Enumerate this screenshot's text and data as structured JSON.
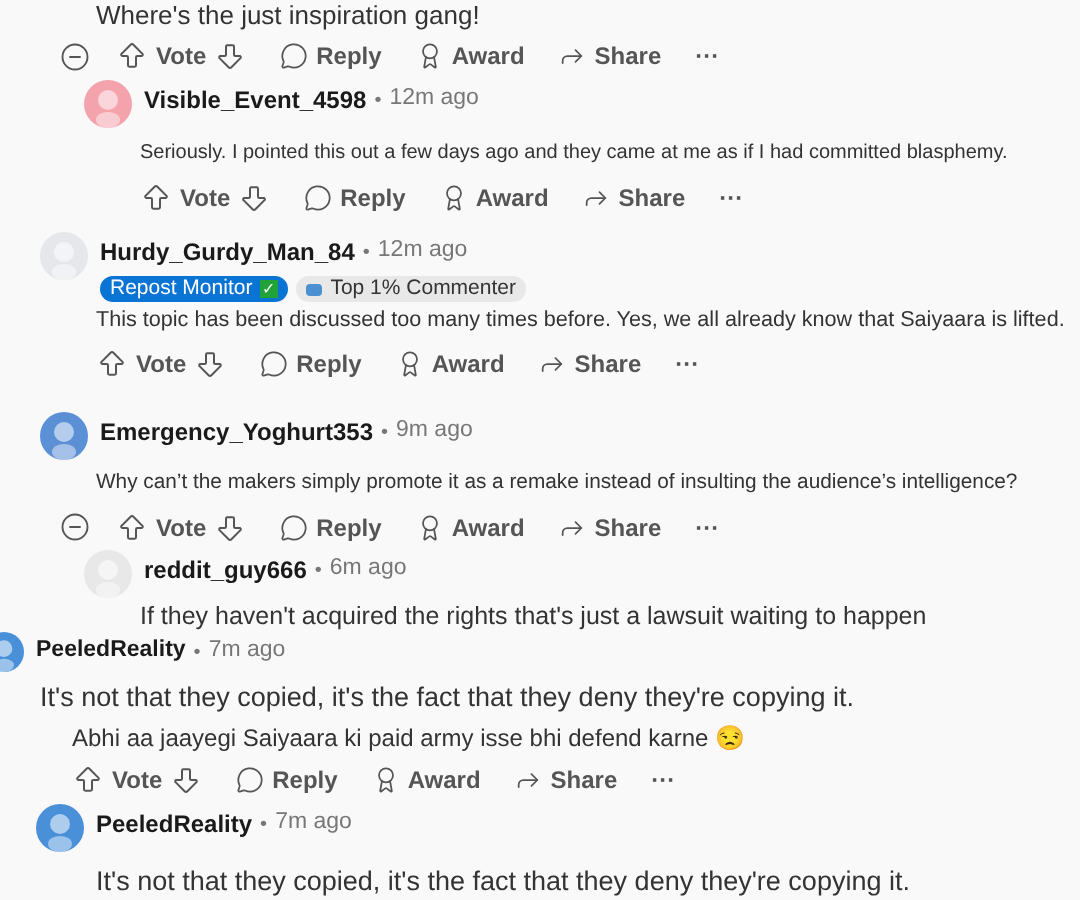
{
  "rows": [
    {
      "kind": "text",
      "text": "Where's the just inspiration gang!"
    },
    {
      "kind": "actions",
      "collapse": true,
      "vote": "Vote",
      "reply": "Reply",
      "award": "Award",
      "share": "Share",
      "more": "···"
    },
    {
      "kind": "author",
      "name": "Visible_Event_4598",
      "separator": "•",
      "time": "12m ago",
      "color": "#f4a3ad"
    },
    {
      "kind": "text",
      "text": "Seriously. I pointed this out a few days ago and they came at me as if I had committed blasphemy."
    },
    {
      "kind": "actions",
      "collapse": false,
      "vote": "Vote",
      "reply": "Reply",
      "award": "Award",
      "share": "Share",
      "more": "···"
    },
    {
      "kind": "author",
      "name": "Hurdy_Gurdy_Man_84",
      "separator": "•",
      "time": "12m ago",
      "color": "#e5e7eb",
      "badges": [
        {
          "kind": "flair",
          "label": "Repost Monitor",
          "check": "✓"
        },
        {
          "kind": "achievement",
          "label": "Top 1% Commenter"
        }
      ]
    },
    {
      "kind": "text",
      "text": "This topic has been discussed too many times before. Yes, we all already know that Saiyaara is lifted."
    },
    {
      "kind": "actions",
      "collapse": false,
      "vote": "Vote",
      "reply": "Reply",
      "award": "Award",
      "share": "Share",
      "more": "···"
    },
    {
      "kind": "author",
      "name": "Emergency_Yoghurt353",
      "separator": "•",
      "time": "9m ago",
      "color": "#5b8fd6"
    },
    {
      "kind": "text",
      "text": "Why can’t the makers simply promote it as a remake instead of insulting the audience’s intelligence?"
    },
    {
      "kind": "actions",
      "collapse": true,
      "vote": "Vote",
      "reply": "Reply",
      "award": "Award",
      "share": "Share",
      "more": "···"
    },
    {
      "kind": "author",
      "name": "reddit_guy666",
      "separator": "•",
      "time": "6m ago",
      "color": "#e8e8e8"
    },
    {
      "kind": "text",
      "text": "If they haven't acquired the rights that's just a lawsuit waiting to happen"
    },
    {
      "kind": "author",
      "name": "PeeledReality",
      "separator": "•",
      "time": "7m ago",
      "color": "#4a90d9"
    },
    {
      "kind": "text",
      "text": "It's not that they copied, it's the fact that they deny they're copying it."
    },
    {
      "kind": "text",
      "text": "Abhi aa jaayegi Saiyaara ki paid army isse bhi defend karne 😒"
    },
    {
      "kind": "actions",
      "collapse": false,
      "vote": "Vote",
      "reply": "Reply",
      "award": "Award",
      "share": "Share",
      "more": "···"
    },
    {
      "kind": "author",
      "name": "PeeledReality",
      "separator": "•",
      "time": "7m ago",
      "color": "#4a90d9"
    },
    {
      "kind": "text",
      "text": "It's not that they copied, it's the fact that they deny they're copying it."
    }
  ]
}
